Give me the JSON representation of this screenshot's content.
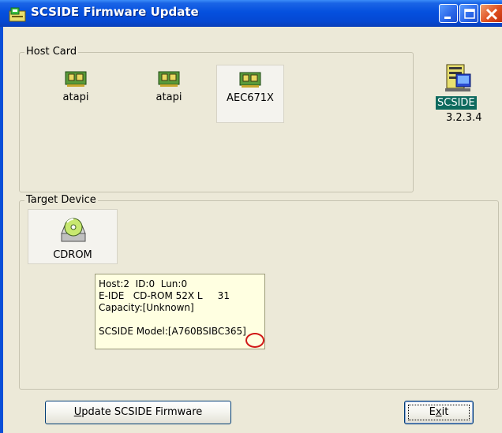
{
  "window": {
    "title": "SCSIDE Firmware Update"
  },
  "host_card": {
    "label": "Host Card",
    "cards": [
      {
        "label": "atapi",
        "selected": false
      },
      {
        "label": "atapi",
        "selected": false
      },
      {
        "label": "AEC671X",
        "selected": true
      }
    ]
  },
  "app_badge": {
    "name": "SCSIDE",
    "version": "3.2.3.4"
  },
  "target_device": {
    "label": "Target Device",
    "devices": [
      {
        "label": "CDROM"
      }
    ]
  },
  "tooltip": {
    "line1": "Host:2  ID:0  Lun:0",
    "line2": "E-IDE   CD-ROM 52X L     31",
    "line3": "Capacity:[Unknown]",
    "line4_prefix": "SCSIDE Model:[A760BSIBC",
    "line4_highlight": "365",
    "line4_suffix": "]"
  },
  "buttons": {
    "update_label_u": "U",
    "update_label_rest": "pdate SCSIDE Firmware",
    "exit_label_x_pre": "E",
    "exit_label_x": "x",
    "exit_label_rest": "it"
  },
  "colors": {
    "titlebar": "#0550de",
    "face": "#ece9d8",
    "tooltip_bg": "#ffffe1",
    "highlight": "#d01818",
    "badge_bg": "#0e6a5e"
  }
}
